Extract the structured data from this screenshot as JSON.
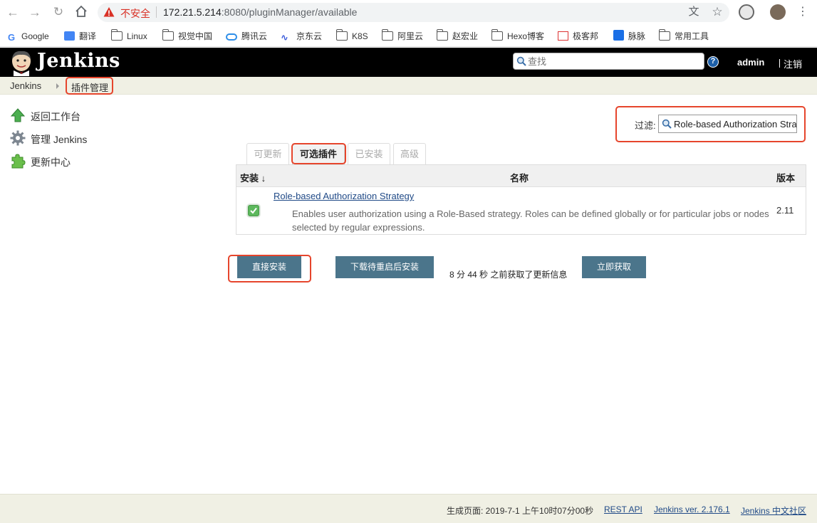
{
  "browser": {
    "not_secure": "不安全",
    "url_host": "172.21.5.214",
    "url_rest": ":8080/pluginManager/available",
    "bookmarks": [
      "Google",
      "翻译",
      "Linux",
      "视觉中国",
      "腾讯云",
      "京东云",
      "K8S",
      "阿里云",
      "赵宏业",
      "Hexo博客",
      "极客邦",
      "脉脉",
      "常用工具"
    ]
  },
  "header": {
    "title": "Jenkins",
    "search_placeholder": "查找",
    "help": "?",
    "user": "admin",
    "logout": "注销"
  },
  "breadcrumb": {
    "root": "Jenkins",
    "current": "插件管理"
  },
  "sidebar": {
    "items": [
      {
        "label": "返回工作台",
        "icon": "up-arrow-icon"
      },
      {
        "label": "管理 Jenkins",
        "icon": "gear-icon"
      },
      {
        "label": "更新中心",
        "icon": "puzzle-icon"
      }
    ]
  },
  "filter": {
    "label": "过滤:",
    "value": "Role-based Authorization Strategy"
  },
  "tabs": [
    {
      "label": "可更新",
      "active": false
    },
    {
      "label": "可选插件",
      "active": true
    },
    {
      "label": "已安装",
      "active": false
    },
    {
      "label": "高级",
      "active": false
    }
  ],
  "table": {
    "col_install": "安装 ↓",
    "col_name": "名称",
    "col_version": "版本",
    "rows": [
      {
        "name": "Role-based Authorization Strategy",
        "description": "Enables user authorization using a Role-Based strategy. Roles can be defined globally or for particular jobs or nodes selected by regular expressions.",
        "version": "2.11",
        "checked": true
      }
    ]
  },
  "actions": {
    "install_now": "直接安装",
    "download_restart": "下载待重启后安装",
    "update_info": "8 分 44 秒 之前获取了更新信息",
    "check_now": "立即获取"
  },
  "footer": {
    "generated": "生成页面: 2019-7-1 上午10时07分00秒",
    "rest_api": "REST API",
    "version": "Jenkins ver. 2.176.1",
    "community": "Jenkins 中文社区"
  },
  "colors": {
    "accent_highlight": "#e6452c",
    "button": "#4b758b",
    "link": "#204a87",
    "header_bg": "#000000",
    "breadcrumb_bg": "#f0f0e4"
  }
}
